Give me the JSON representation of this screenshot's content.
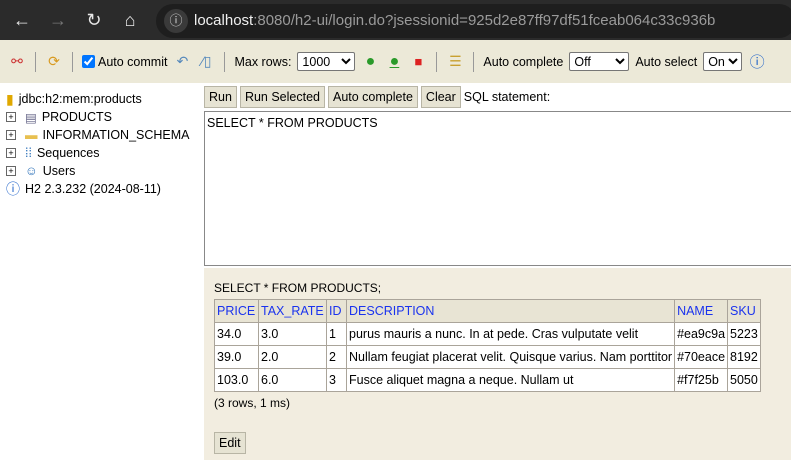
{
  "browser": {
    "url_host": "localhost",
    "url_rest": ":8080/h2-ui/login.do?jsessionid=925d2e87ff97df51fceab064c33c936b"
  },
  "toolbar": {
    "auto_commit": "Auto commit",
    "max_rows_label": "Max rows:",
    "max_rows": "1000",
    "auto_complete_label": "Auto complete",
    "auto_complete": "Off",
    "auto_select_label": "Auto select",
    "auto_select": "On"
  },
  "tree": {
    "connection": "jdbc:h2:mem:products",
    "items": [
      "PRODUCTS",
      "INFORMATION_SCHEMA",
      "Sequences",
      "Users"
    ],
    "version": "H2 2.3.232 (2024-08-11)"
  },
  "buttons": {
    "run": "Run",
    "run_selected": "Run Selected",
    "auto_complete": "Auto complete",
    "clear": "Clear",
    "sql_label": "SQL statement:"
  },
  "sql": "SELECT * FROM PRODUCTS",
  "result": {
    "query": "SELECT * FROM PRODUCTS;",
    "columns": [
      "PRICE",
      "TAX_RATE",
      "ID",
      "DESCRIPTION",
      "NAME",
      "SKU"
    ],
    "rows": [
      [
        "34.0",
        "3.0",
        "1",
        "purus mauris a nunc. In at pede. Cras vulputate velit",
        "#ea9c9a",
        "5223"
      ],
      [
        "39.0",
        "2.0",
        "2",
        "Nullam feugiat placerat velit. Quisque varius. Nam porttitor",
        "#70eace",
        "8192"
      ],
      [
        "103.0",
        "6.0",
        "3",
        "Fusce aliquet magna a neque. Nullam ut",
        "#f7f25b",
        "5050"
      ]
    ],
    "summary": "(3 rows, 1 ms)",
    "edit": "Edit"
  }
}
